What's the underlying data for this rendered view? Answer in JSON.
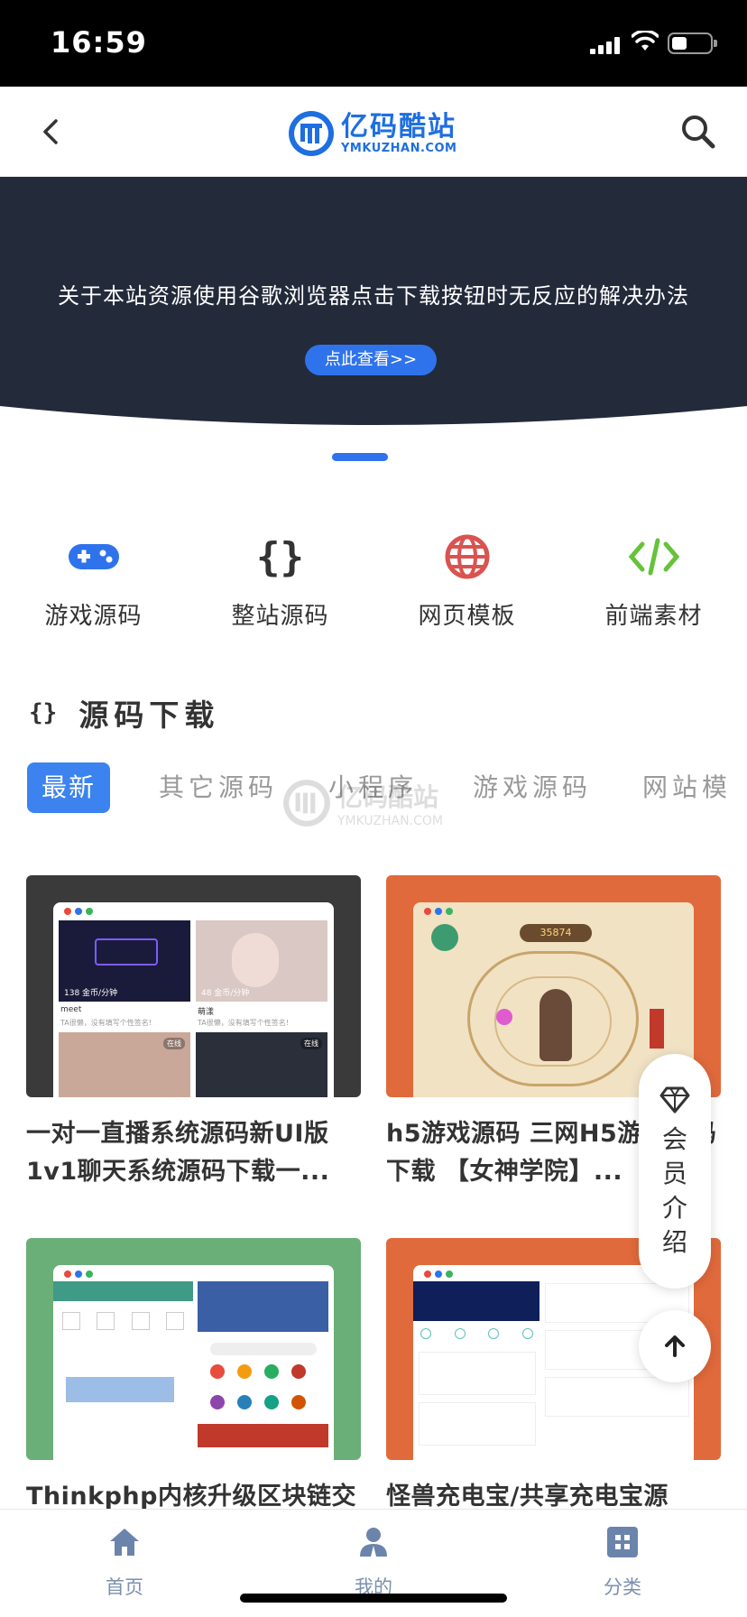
{
  "status_bar": {
    "time": "16:59"
  },
  "header": {
    "logo_cn": "亿码酷站",
    "logo_en": "YMKUZHAN.COM",
    "back_icon": "chevron-left-icon",
    "search_icon": "search-icon"
  },
  "banner": {
    "text": "关于本站资源使用谷歌浏览器点击下载按钮时无反应的解决办法",
    "button": "点此查看>>",
    "bg_color": "#232a3a",
    "accent": "#2f73ec"
  },
  "categories": [
    {
      "label": "游戏源码",
      "icon": "gamepad-icon",
      "color": "#2f73ec"
    },
    {
      "label": "整站源码",
      "icon": "braces-icon",
      "color": "#333333"
    },
    {
      "label": "网页模板",
      "icon": "globe-icon",
      "color": "#d9534f"
    },
    {
      "label": "前端素材",
      "icon": "code-icon",
      "color": "#67c23a"
    }
  ],
  "section": {
    "title": "源码下载",
    "icon": "braces-icon"
  },
  "tabs": [
    "最新",
    "其它源码",
    "小程序",
    "游戏源码",
    "网站模"
  ],
  "watermark": {
    "cn": "亿码酷站",
    "en": "YMKUZHAN.COM"
  },
  "cards": [
    {
      "title": "一对一直播系统源码新UI版1v1聊天系统源码下载一...",
      "bg": "#3a3a3a"
    },
    {
      "title": "h5游戏源码 三网H5游戏源码下载 【女神学院】...",
      "bg": "#e06a3c"
    },
    {
      "title": "Thinkphp内核升级区块链交",
      "bg": "#6aae78"
    },
    {
      "title": "怪兽充电宝/共享充电宝源",
      "bg": "#e06a3c"
    }
  ],
  "card_shot_text": {
    "c1_a": "138 金币/分钟",
    "c1_b": "48 金币/分钟",
    "c1_name1": "meet",
    "c1_name2": "萌漾",
    "c1_sig1": "TA很懒，没有填写个性签名!",
    "c1_sig2": "TA很懒，没有填写个性签名!",
    "c1_online": "在线",
    "c1_online2": "在线",
    "c2_score": "35874"
  },
  "float": {
    "member_text": "会员介绍",
    "member_icon": "diamond-icon",
    "top_icon": "arrow-up-icon"
  },
  "bottom_nav": [
    {
      "label": "首页",
      "icon": "home-icon",
      "active": true
    },
    {
      "label": "我的",
      "icon": "user-icon",
      "active": false
    },
    {
      "label": "分类",
      "icon": "grid-icon",
      "active": false
    }
  ]
}
